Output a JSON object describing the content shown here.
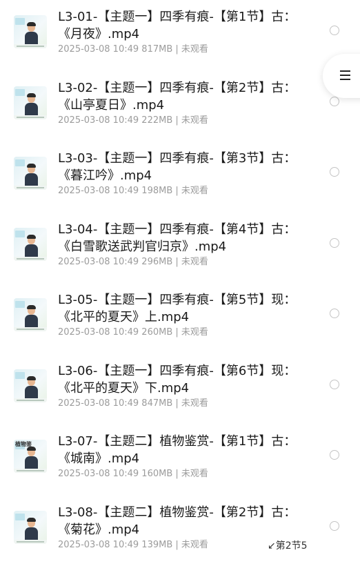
{
  "files": [
    {
      "title": "L3-01-【主题一】四季有痕-【第1节】古：《月夜》.mp4",
      "date": "2025-03-08 10:49",
      "size": "817MB",
      "status": "未观看"
    },
    {
      "title": "L3-02-【主题一】四季有痕-【第2节】古：《山亭夏日》.mp4",
      "date": "2025-03-08 10:49",
      "size": "222MB",
      "status": "未观看"
    },
    {
      "title": "L3-03-【主题一】四季有痕-【第3节】古：《暮江吟》.mp4",
      "date": "2025-03-08 10:49",
      "size": "198MB",
      "status": "未观看"
    },
    {
      "title": "L3-04-【主题一】四季有痕-【第4节】古：《白雪歌送武判官归京》.mp4",
      "date": "2025-03-08 10:49",
      "size": "296MB",
      "status": "未观看"
    },
    {
      "title": "L3-05-【主题一】四季有痕-【第5节】现：《北平的夏天》上.mp4",
      "date": "2025-03-08 10:49",
      "size": "260MB",
      "status": "未观看"
    },
    {
      "title": "L3-06-【主题一】四季有痕-【第6节】现：《北平的夏天》下.mp4",
      "date": "2025-03-08 10:49",
      "size": "847MB",
      "status": "未观看"
    },
    {
      "title": "L3-07-【主题二】植物鉴赏-【第1节】古：《城南》.mp4",
      "date": "2025-03-08 10:49",
      "size": "160MB",
      "status": "未观看",
      "thumb_text": "植物鉴"
    },
    {
      "title": "L3-08-【主题二】植物鉴赏-【第2节】古：《菊花》.mp4",
      "date": "2025-03-08 10:49",
      "size": "139MB",
      "status": "未观看"
    }
  ],
  "meta_separator": "|",
  "corner_note": "↙第2节5",
  "icons": {
    "thumbnail": "video-thumbnail-icon",
    "radio": "radio-circle-icon",
    "menu": "hamburger-menu-icon"
  },
  "colors": {
    "title": "#1a1a1a",
    "meta": "#9b9b9b",
    "radio_border": "#c4c4c4",
    "background": "#ffffff"
  }
}
